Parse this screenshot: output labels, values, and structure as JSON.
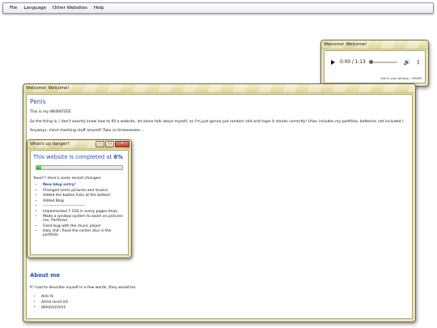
{
  "menubar": {
    "items": [
      "File",
      "Language",
      "Other Websites",
      "Help"
    ]
  },
  "music_window": {
    "title": "Welcome! Welcome!",
    "time": "0:00 / 1:13",
    "progress": 0.0,
    "credit": "See in your fantasy - OMORI"
  },
  "main_window": {
    "title": "Welcome! Welcome!",
    "heading": "Penis",
    "paragraphs": [
      "This is my WEBSITEEE",
      "So the thing is, i don't exactly know how to fill a website, let alone talk about myself, so I'm just gonna put random shit and hope it stands correctly! (Also includes my portfolio, batteries not included.)",
      "Anyways, mind checking stuff around? Take ur timeeeeeee-..."
    ],
    "about_heading": "About me",
    "about_text": "If i had to describe myself in a few words, they would be:",
    "about_list": [
      "Anti Ai",
      "Artist (kind of)",
      "gayyyyyyyyy"
    ]
  },
  "popup_window": {
    "title": "What's up danger?",
    "controls": {
      "minimize": "—",
      "maximize": "☐",
      "close": "✕"
    },
    "headline_prefix": "This website is completed at ",
    "headline_percent": "6%",
    "progress_percent": 6,
    "intro": "Yooo!!! Here's some recent changes:",
    "changes": [
      "New blog entry!",
      "Changed some pictures and musics",
      "Added the button links at the bottom",
      "Added Blog",
      "--------------------------------",
      "Implemented 7.CSS in every pages lmao",
      "Made a window system to zoom on pictures (ex: Portfolio)",
      "Fixed bug with the music player",
      "Holy shit i fixed the center divs in the portfolio"
    ]
  },
  "colors": {
    "window_frame": "#e9e3b7",
    "heading_blue": "#2c4fa8",
    "progress_green": "#2fa52a"
  }
}
